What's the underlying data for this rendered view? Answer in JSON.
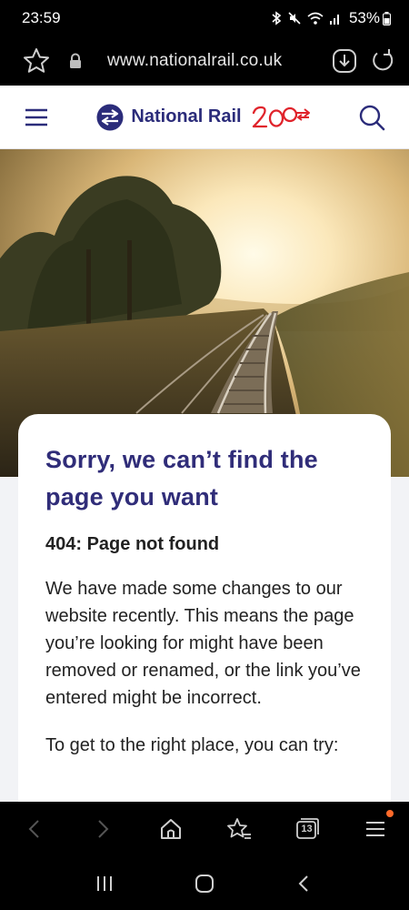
{
  "status_bar": {
    "time": "23:59",
    "battery": "53%",
    "icons": [
      "bluetooth-icon",
      "mute-icon",
      "wifi-icon",
      "signal-icon"
    ]
  },
  "browser": {
    "url": "www.nationalrail.co.uk",
    "icons": [
      "star-icon",
      "lock-icon",
      "download-icon",
      "reload-icon"
    ]
  },
  "header": {
    "logo_text": "National Rail",
    "icons": [
      "menu-icon",
      "national-rail-logo-icon",
      "search-icon"
    ],
    "brand_color": "#2b2c7a",
    "anniversary_color": "#e0232b"
  },
  "page": {
    "title": "Sorry, we can’t find the page you want",
    "error_code": "404: Page not found",
    "body": "We have made some changes to our website recently. This means the page you’re looking for might have been removed or renamed, or the link you’ve entered might be incorrect.",
    "try_text": "To get to the right place, you can try:"
  },
  "browser_nav": {
    "tabs_count": "13",
    "icons": [
      "back-icon",
      "forward-icon",
      "home-icon",
      "bookmarks-icon",
      "tabs-icon",
      "menu-icon"
    ]
  },
  "system_nav": {
    "icons": [
      "recents-icon",
      "home-icon",
      "back-icon"
    ]
  }
}
